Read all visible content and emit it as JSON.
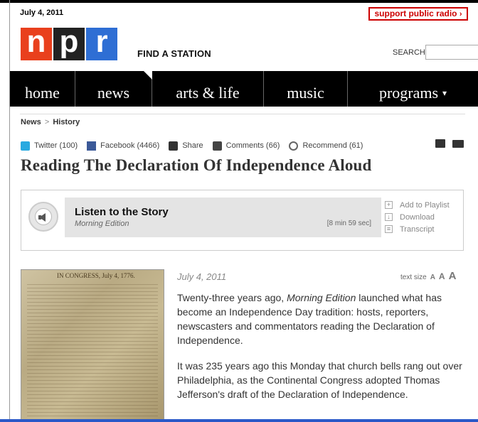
{
  "header": {
    "date": "July 4, 2011",
    "support_label": "support public radio",
    "support_arrow": "›",
    "logo_letters": [
      "n",
      "p",
      "r"
    ],
    "find_station": "FIND A STATION",
    "search_label": "SEARCH",
    "search_value": ""
  },
  "nav": {
    "items": [
      {
        "label": "home"
      },
      {
        "label": "news"
      },
      {
        "label": "arts & life"
      },
      {
        "label": "music"
      },
      {
        "label": "programs"
      }
    ],
    "programs_caret": "▾"
  },
  "breadcrumb": {
    "section": "News",
    "separator": ">",
    "topic": "History"
  },
  "social": {
    "twitter": "Twitter (100)",
    "facebook": "Facebook (4466)",
    "share": "Share",
    "comments": "Comments (66)",
    "recommend": "Recommend (61)"
  },
  "article": {
    "headline": "Reading The Declaration Of Independence Aloud",
    "date": "July 4, 2011",
    "text_size_label": "text size",
    "text_size_letters": [
      "A",
      "A",
      "A"
    ],
    "paragraphs": [
      {
        "before": "Twenty-three years ago, ",
        "emphasis": "Morning Edition",
        "after": " launched what has become an Independence Day tradition: hosts, reporters, newscasters and commentators reading the Declaration of Independence."
      },
      {
        "text": "It was 235 years ago this Monday that church bells rang out over Philadelphia, as the Continental Congress adopted Thomas Jefferson's draft of the Declaration of Independence."
      }
    ],
    "image_caption": "IN CONGRESS, July 4, 1776."
  },
  "audio": {
    "title": "Listen to the Story",
    "program": "Morning Edition",
    "duration": "[8 min 59 sec]",
    "actions": [
      {
        "symbol": "+",
        "label": "Add to Playlist"
      },
      {
        "symbol": "↓",
        "label": "Download"
      },
      {
        "symbol": "≡",
        "label": "Transcript"
      }
    ]
  },
  "colors": {
    "logo_n": "#e9401d",
    "logo_p": "#222222",
    "logo_r": "#2e6ed4",
    "support": "#cc0000",
    "nav_bg": "#000000"
  }
}
